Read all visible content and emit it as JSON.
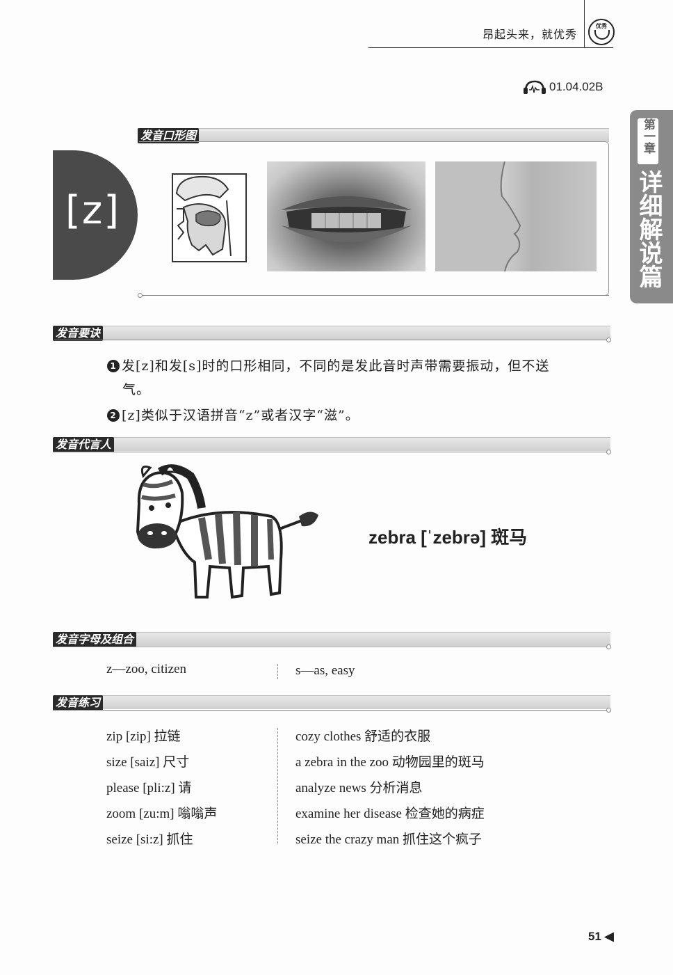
{
  "header": {
    "title": "昂起头来，就优秀",
    "logo_text": "优秀"
  },
  "audio": {
    "icon": "headphones-icon",
    "code": "01.04.02B"
  },
  "side_tab": {
    "chapter": "第一章",
    "title": "详细解说篇"
  },
  "sections": {
    "mouth_shape": "发音口形图",
    "key_points": "发音要诀",
    "spokesperson": "发音代言人",
    "letters": "发音字母及组合",
    "practice": "发音练习"
  },
  "phoneme": "[z]",
  "key_points": [
    {
      "num": "1",
      "line1": "发[z]和发[s]时的口形相同，不同的是发此音时声带需要振动，但不送",
      "line2": "气。"
    },
    {
      "num": "2",
      "line1": "[z]类似于汉语拼音“z”或者汉字“滋”。"
    }
  ],
  "spokesperson_word": "zebra [ˈzebrə] 斑马",
  "letters": {
    "left": "z—zoo, citizen",
    "right": "s—as, easy"
  },
  "practice": {
    "left": [
      "zip [zip] 拉链",
      "size [saiz] 尺寸",
      "please [pli:z] 请",
      "zoom [zu:m] 嗡嗡声",
      "seize [si:z] 抓住"
    ],
    "right": [
      "cozy clothes  舒适的衣服",
      "a zebra in the zoo  动物园里的斑马",
      "analyze news  分析消息",
      "examine her disease  检查她的病症",
      "seize the crazy man  抓住这个疯子"
    ]
  },
  "page_number": "51"
}
